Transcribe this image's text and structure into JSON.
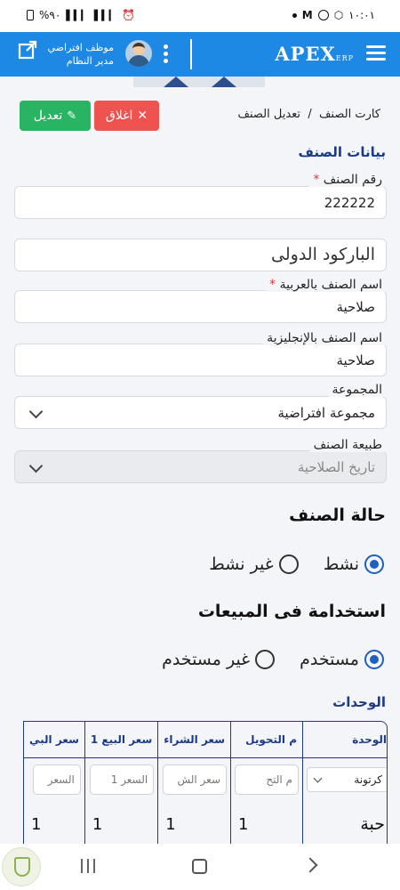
{
  "status_bar": {
    "battery_pct": "%٩٠",
    "time": "١٠:٠١"
  },
  "header": {
    "logo_text": "APEX",
    "logo_sub": "ERP",
    "user_name": "موظف افتراضي",
    "user_role": "مدير النظام"
  },
  "toolbar": {
    "edit_label": "تعديل",
    "close_label": "اغلاق"
  },
  "breadcrumb": {
    "parent": "كارت الصنف",
    "separator": "/",
    "current": "تعديل الصنف"
  },
  "form": {
    "section_title": "بيانات الصنف",
    "item_number": {
      "label": "رقم الصنف",
      "required": "*",
      "value": "222222"
    },
    "barcode": {
      "placeholder": "الباركود الدولى"
    },
    "name_ar": {
      "label": "اسم الصنف بالعربية",
      "required": "*",
      "value": "صلاحية"
    },
    "name_en": {
      "label": "اسم الصنف بالإنجليزية",
      "value": "صلاحية"
    },
    "group": {
      "label": "المجموعة",
      "value": "مجموعة افتراضية"
    },
    "item_type": {
      "label": "طبيعة الصنف",
      "value": "تاريخ الصلاحية"
    }
  },
  "status_section": {
    "title": "حالة الصنف",
    "options": [
      {
        "label": "نشط",
        "selected": true
      },
      {
        "label": "غير نشط",
        "selected": false
      }
    ]
  },
  "sales_section": {
    "title": "استخدامة فى المبيعات",
    "options": [
      {
        "label": "مستخدم",
        "selected": true
      },
      {
        "label": "غير مستخدم",
        "selected": false
      }
    ]
  },
  "units": {
    "title": "الوحدات",
    "headers": [
      "الوحدة",
      "م التحويل",
      "سعر الشراء",
      "سعر البيع 1",
      "سعر البي"
    ],
    "input_row": {
      "unit_select": "كرتونة",
      "placeholders": [
        "م التح",
        "سعر الش",
        "السعر 1",
        "السعر"
      ]
    },
    "data_row": {
      "unit": "حبة",
      "values": [
        "1",
        "1",
        "1",
        "1"
      ]
    }
  }
}
